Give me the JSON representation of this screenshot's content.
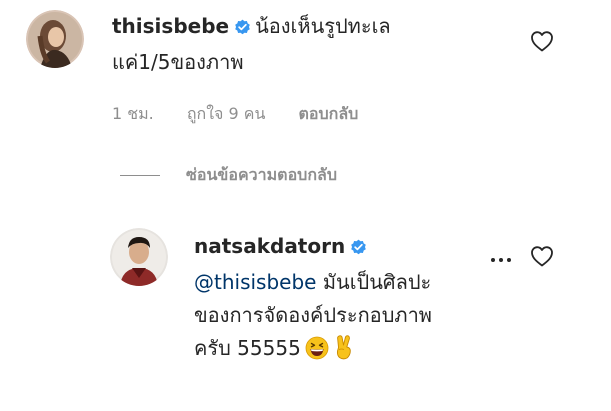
{
  "comment": {
    "username": "thisisbebe",
    "text_line1": "น้องเห็นรูปทะเล",
    "text_line2": "แค่1/5ของภาพ",
    "time": "1 ชม.",
    "likes": "ถูกใจ 9 คน",
    "reply_label": "ตอบกลับ",
    "verified_icon": "verified-badge-icon",
    "heart_icon": "heart-outline-icon"
  },
  "hide_replies": {
    "label": "ซ่อนข้อความตอบกลับ"
  },
  "reply": {
    "username": "natsakdatorn",
    "mention": "@thisisbebe",
    "text_line1": "มันเป็นศิลปะ",
    "text_line2": "ของการจัดองค์ประกอบภาพ",
    "text_line3": "ครับ 55555",
    "emojis": [
      "grinning-squinting-face-emoji",
      "victory-hand-emoji"
    ],
    "more_icon": "more-options-icon",
    "heart_icon": "heart-outline-icon"
  },
  "colors": {
    "text": "#262626",
    "secondary": "#8e8e8e",
    "verified": "#3897f0",
    "mention": "#003569"
  }
}
